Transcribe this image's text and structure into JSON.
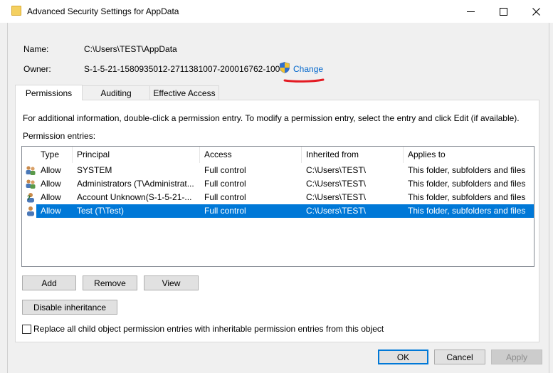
{
  "window": {
    "title": "Advanced Security Settings for AppData"
  },
  "info": {
    "name_label": "Name:",
    "name_value": "C:\\Users\\TEST\\AppData",
    "owner_label": "Owner:",
    "owner_value": "S-1-5-21-1580935012-2711381007-200016762-1004",
    "change_link": "Change"
  },
  "tabs": [
    {
      "label": "Permissions",
      "active": true
    },
    {
      "label": "Auditing",
      "active": false
    },
    {
      "label": "Effective Access",
      "active": false
    }
  ],
  "permissions": {
    "description": "For additional information, double-click a permission entry. To modify a permission entry, select the entry and click Edit (if available).",
    "entries_label": "Permission entries:",
    "columns": [
      "Type",
      "Principal",
      "Access",
      "Inherited from",
      "Applies to"
    ],
    "rows": [
      {
        "type": "Allow",
        "principal": "SYSTEM",
        "access": "Full control",
        "inherited_from": "C:\\Users\\TEST\\",
        "applies_to": "This folder, subfolders and files",
        "icon": "group-users-icon"
      },
      {
        "type": "Allow",
        "principal": "Administrators (T\\Administrat...",
        "access": "Full control",
        "inherited_from": "C:\\Users\\TEST\\",
        "applies_to": "This folder, subfolders and files",
        "icon": "group-users-icon"
      },
      {
        "type": "Allow",
        "principal": "Account Unknown(S-1-5-21-...",
        "access": "Full control",
        "inherited_from": "C:\\Users\\TEST\\",
        "applies_to": "This folder, subfolders and files",
        "icon": "unknown-user-icon"
      },
      {
        "type": "Allow",
        "principal": "Test (T\\Test)",
        "access": "Full control",
        "inherited_from": "C:\\Users\\TEST\\",
        "applies_to": "This folder, subfolders and files",
        "icon": "user-icon",
        "selected": true
      }
    ],
    "add_label": "Add",
    "remove_label": "Remove",
    "view_label": "View",
    "disable_inheritance_label": "Disable inheritance",
    "replace_checkbox_label": "Replace all child object permission entries with inheritable permission entries from this object",
    "replace_checked": false
  },
  "footer": {
    "ok_label": "OK",
    "cancel_label": "Cancel",
    "apply_label": "Apply"
  },
  "colors": {
    "selection": "#0078d7",
    "link": "#0066cc",
    "annotation": "#e31b23"
  }
}
